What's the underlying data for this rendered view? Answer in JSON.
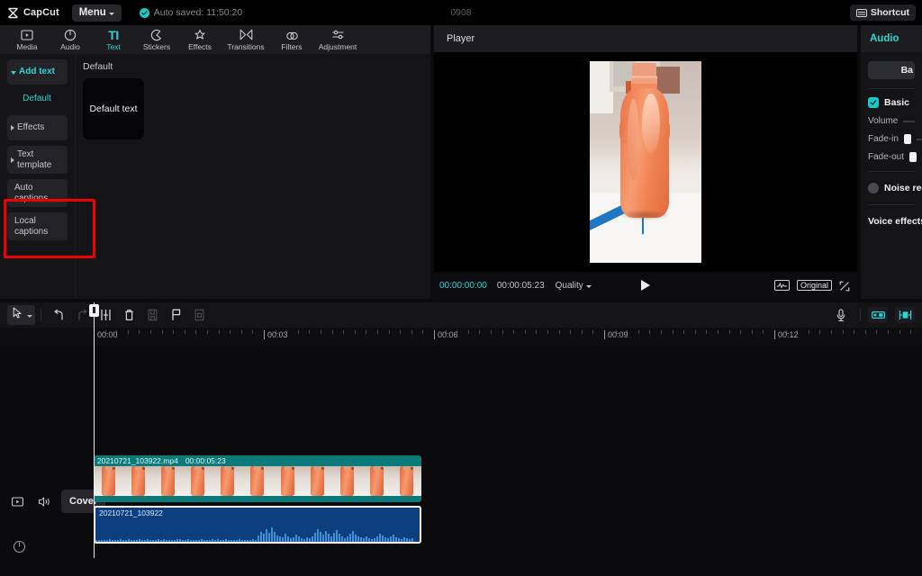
{
  "titlebar": {
    "app_name": "CapCut",
    "logo_icon": "capcut-logo-icon",
    "menu_label": "Menu",
    "autosave_text": "Auto saved: 11:50:20",
    "autosave_icon": "check-circle-icon",
    "project_id": "0908",
    "shortcut_label": "Shortcut",
    "shortcut_icon": "keyboard-icon"
  },
  "tabs": [
    {
      "label": "Media",
      "icon": "media-icon",
      "active": false
    },
    {
      "label": "Audio",
      "icon": "audio-note-icon",
      "active": false
    },
    {
      "label": "Text",
      "icon": "text-ti-icon",
      "active": true
    },
    {
      "label": "Stickers",
      "icon": "sticker-icon",
      "active": false
    },
    {
      "label": "Effects",
      "icon": "effects-sparkle-icon",
      "active": false
    },
    {
      "label": "Transitions",
      "icon": "transitions-icon",
      "active": false
    },
    {
      "label": "Filters",
      "icon": "filters-icon",
      "active": false
    },
    {
      "label": "Adjustment",
      "icon": "adjustment-sliders-icon",
      "active": false
    }
  ],
  "sidebar": {
    "items": [
      {
        "label": "Add text",
        "kind": "accent",
        "arrow": "down"
      },
      {
        "label": "Default",
        "kind": "plain",
        "arrow": "none"
      },
      {
        "label": "Effects",
        "kind": "normal",
        "arrow": "right"
      },
      {
        "label": "Text template",
        "kind": "normal",
        "arrow": "right"
      },
      {
        "label": "Auto captions",
        "kind": "normal",
        "arrow": "none"
      },
      {
        "label": "Local captions",
        "kind": "normal",
        "arrow": "none"
      }
    ]
  },
  "presets": {
    "group_title": "Default",
    "card_label": "Default text"
  },
  "annotation": {
    "color": "#f00000",
    "targets": "Auto captions / Local captions"
  },
  "player": {
    "title": "Player",
    "current_time": "00:00:00:00",
    "duration": "00:00:05:23",
    "quality_label": "Quality",
    "play_icon": "play-icon",
    "waveform_icon": "audio-waveform-icon",
    "original_label": "Original",
    "fullscreen_icon": "fullscreen-icon",
    "preview_description": "orange plastic water bottle on white table"
  },
  "right_panel": {
    "title": "Audio",
    "tab_label": "Ba",
    "basic_label": "Basic",
    "basic_checked": true,
    "volume_label": "Volume",
    "fade_in_label": "Fade-in",
    "fade_out_label": "Fade-out",
    "noise_label": "Noise red",
    "voice_effects_label": "Voice effects",
    "accent_color": "#2fd4d4"
  },
  "timeline": {
    "toolbar": [
      {
        "name": "select-tool",
        "icon": "cursor-arrow-icon",
        "enabled": true
      },
      {
        "name": "undo",
        "icon": "undo-icon",
        "enabled": true
      },
      {
        "name": "redo",
        "icon": "redo-icon",
        "enabled": false
      },
      {
        "name": "split",
        "icon": "split-icon",
        "enabled": true
      },
      {
        "name": "delete",
        "icon": "trash-icon",
        "enabled": true
      },
      {
        "name": "freeze",
        "icon": "freeze-flag-icon",
        "enabled": false
      },
      {
        "name": "marker",
        "icon": "marker-flag-icon",
        "enabled": true
      },
      {
        "name": "crop-flag",
        "icon": "crop-flag-icon",
        "enabled": false
      }
    ],
    "mic_icon": "microphone-icon",
    "mixer_icon": "mixer-icon",
    "zoom_icon": "timeline-zoom-icon",
    "ruler_labels": [
      "00:00",
      "00:03",
      "00:06",
      "00:09",
      "00:12"
    ],
    "playhead_time": "00:00",
    "track_headers": {
      "video_icon": "video-track-icon",
      "mute_icon": "mute-speaker-icon",
      "cover_label": "Cover",
      "audio_icon": "audio-track-icon"
    },
    "video_clip": {
      "name": "20210721_103922.mp4",
      "duration": "00:00:05:23",
      "selected": false,
      "color": "#0d7a7a"
    },
    "audio_clip": {
      "name": "20210721_103922",
      "selected": true,
      "color": "#0d3f7e"
    }
  }
}
